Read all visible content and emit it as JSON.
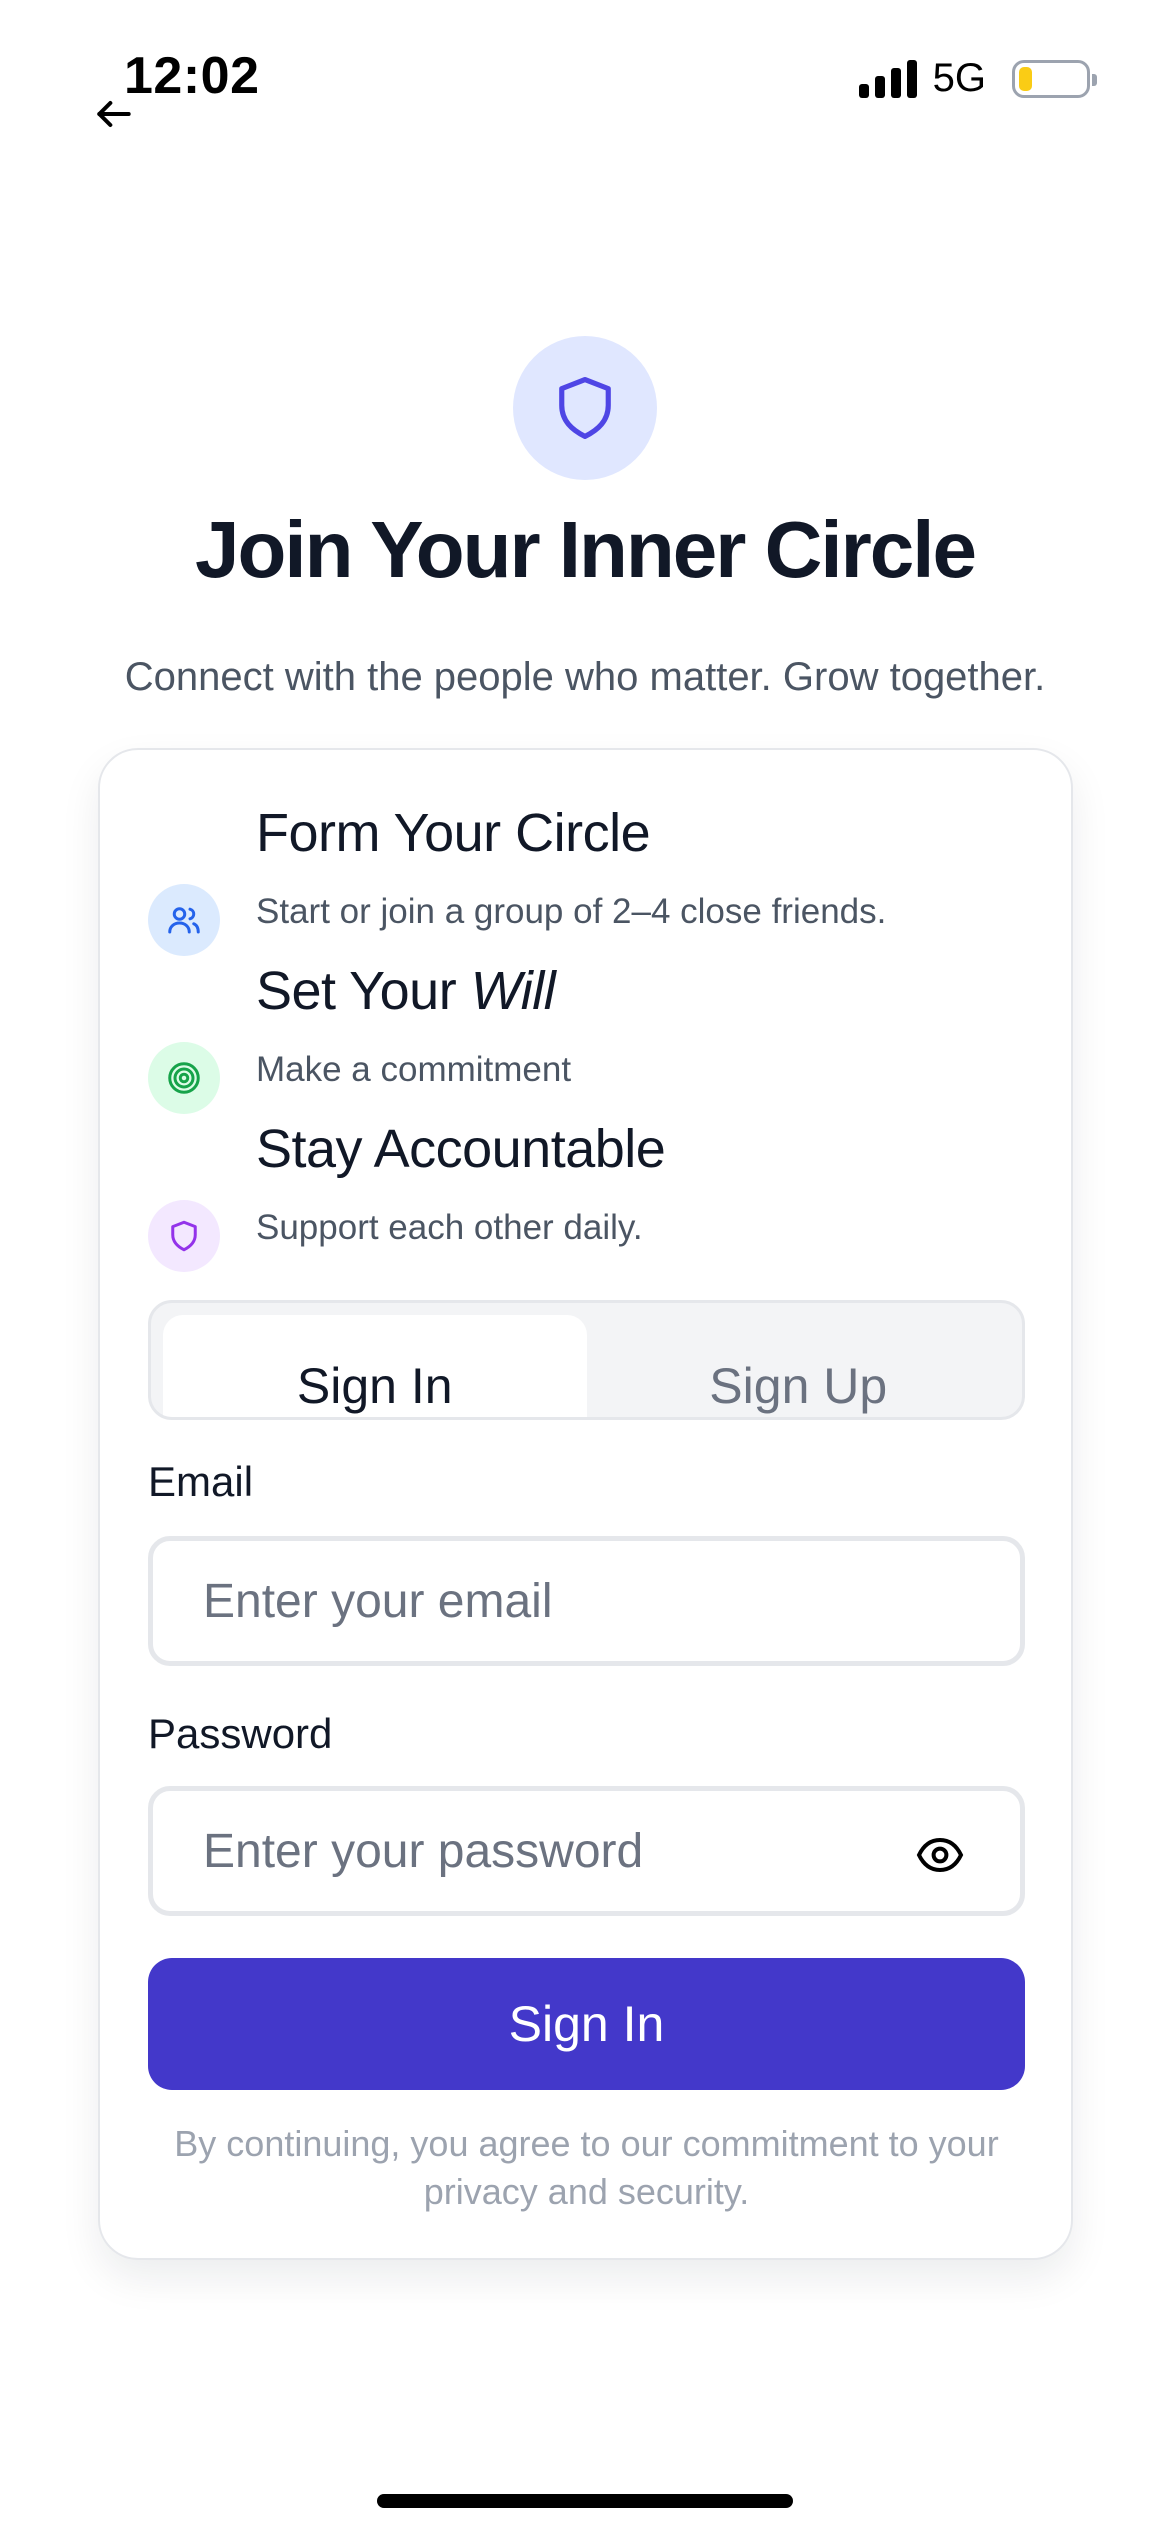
{
  "status_bar": {
    "time": "12:02",
    "network": "5G",
    "battery_level": 0.2,
    "icons": [
      "back-arrow-icon",
      "signal-icon",
      "battery-icon"
    ]
  },
  "header": {
    "icon": "shield-icon",
    "title": "Join Your Inner Circle",
    "subtitle": "Connect with the people who matter. Grow together."
  },
  "features": [
    {
      "icon": "users-icon",
      "title": "Form Your Circle",
      "description": "Start or join a group of 2–4 close friends."
    },
    {
      "icon": "target-icon",
      "title_prefix": "Set Your ",
      "title_emphasis": "Will",
      "description": "Make a commitment"
    },
    {
      "icon": "shield-icon",
      "title": "Stay Accountable",
      "description": "Support each other daily."
    }
  ],
  "tabs": [
    {
      "label": "Sign In",
      "active": true
    },
    {
      "label": "Sign Up",
      "active": false
    }
  ],
  "form": {
    "email_label": "Email",
    "email_placeholder": "Enter your email",
    "email_value": "",
    "password_label": "Password",
    "password_placeholder": "Enter your password",
    "password_value": "",
    "password_toggle_icon": "eye-icon",
    "submit_label": "Sign In",
    "legal": "By continuing, you agree to our commitment to your privacy and security."
  },
  "colors": {
    "primary": "#4338ca",
    "hero_icon_bg": "#e0e7ff",
    "feature_blue_bg": "#dbeafe",
    "feature_green_bg": "#dcfce7",
    "feature_purple_bg": "#f3e8ff",
    "battery": "#facc15"
  }
}
